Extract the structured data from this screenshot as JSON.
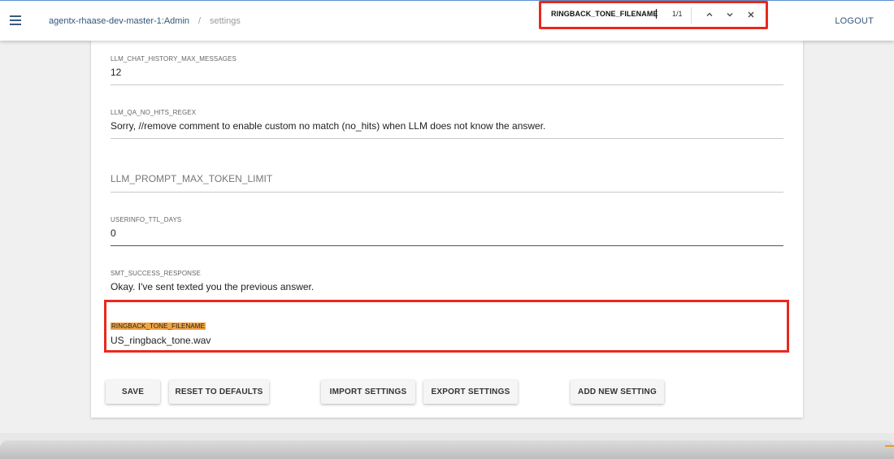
{
  "header": {
    "app_name": "agentx-rhaase-dev-master-1:Admin",
    "separator": "/",
    "page": "settings",
    "logout_label": "LOGOUT"
  },
  "findbar": {
    "query": "RINGBACK_TONE_FILENAME",
    "count": "1/1"
  },
  "fields": [
    {
      "label": "LLM_CHAT_HISTORY_MAX_MESSAGES",
      "value": "12"
    },
    {
      "label": "LLM_QA_NO_HITS_REGEX",
      "value": "Sorry,  //remove comment to enable custom no match (no_hits) when LLM does not know the answer."
    },
    {
      "label": "LLM_PROMPT_MAX_TOKEN_LIMIT",
      "value": ""
    },
    {
      "label": "USERINFO_TTL_DAYS",
      "value": "0"
    },
    {
      "label": "SMT_SUCCESS_RESPONSE",
      "value": "Okay.  I've sent texted you the previous answer."
    },
    {
      "label": "RINGBACK_TONE_FILENAME",
      "value": "US_ringback_tone.wav"
    }
  ],
  "buttons": {
    "save": "SAVE",
    "reset": "RESET TO DEFAULTS",
    "import": "IMPORT SETTINGS",
    "export": "EXPORT SETTINGS",
    "add": "ADD NEW SETTING"
  },
  "colors": {
    "accent_red": "#e8291c",
    "highlight_orange": "#f2a444",
    "link_blue": "#33557a"
  },
  "icons": [
    "menu-icon",
    "chevron-up-icon",
    "chevron-down-icon",
    "close-icon"
  ]
}
